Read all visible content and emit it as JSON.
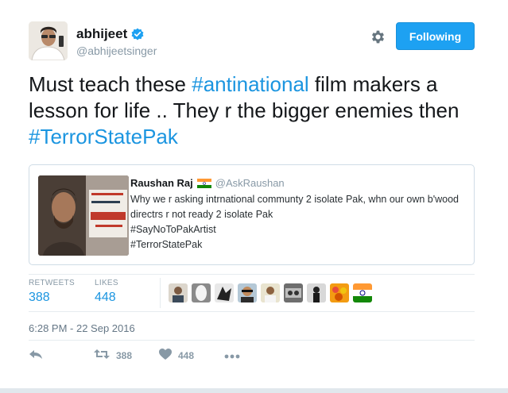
{
  "author": {
    "display_name": "abhijeet",
    "handle": "@abhijeetsinger",
    "verified_icon": "verified-badge-icon"
  },
  "header": {
    "settings_icon": "gear-icon",
    "follow_label": "Following"
  },
  "tweet": {
    "text_parts": [
      {
        "text": "Must teach these ",
        "hashtag": false
      },
      {
        "text": "#antinational",
        "hashtag": true
      },
      {
        "text": " film makers a lesson for life .. They r the bigger enemies then ",
        "hashtag": false
      },
      {
        "text": "#TerrorStatePak",
        "hashtag": true
      }
    ]
  },
  "quoted_tweet": {
    "name": "Raushan Raj",
    "flag_icon": "india-flag-icon",
    "handle": "@AskRaushan",
    "text": "Why we r asking intrnational communty 2 isolate Pak, whn our own b'wood directrs r not ready 2 isolate Pak\n#SayNoToPakArtist\n#TerrorStatePak"
  },
  "stats": {
    "retweets_label": "RETWEETS",
    "retweets_value": "388",
    "likes_label": "LIKES",
    "likes_value": "448"
  },
  "timestamp": "6:28 PM - 22 Sep 2016",
  "actions": {
    "reply_icon": "reply-icon",
    "retweet_icon": "retweet-icon",
    "retweet_count": "388",
    "like_icon": "heart-icon",
    "like_count": "448",
    "more_icon": "more-dots-icon"
  },
  "colors": {
    "accent": "#1da1f2",
    "link": "#1b95e0",
    "muted": "#8899a6"
  }
}
